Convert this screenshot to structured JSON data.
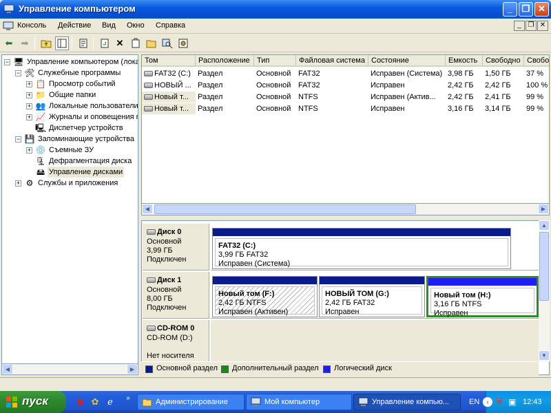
{
  "window": {
    "title": "Управление компьютером"
  },
  "menubar": {
    "items": [
      "Консоль",
      "Действие",
      "Вид",
      "Окно",
      "Справка"
    ]
  },
  "tree": {
    "items": [
      {
        "label": "Управление компьютером (локаль",
        "level": 0,
        "expander": "−",
        "icon": "computer-management-icon"
      },
      {
        "label": "Служебные программы",
        "level": 1,
        "expander": "−",
        "icon": "tools-icon"
      },
      {
        "label": "Просмотр событий",
        "level": 2,
        "expander": "+",
        "icon": "event-viewer-icon"
      },
      {
        "label": "Общие папки",
        "level": 2,
        "expander": "+",
        "icon": "shared-folders-icon"
      },
      {
        "label": "Локальные пользователи и",
        "level": 2,
        "expander": "+",
        "icon": "users-icon"
      },
      {
        "label": "Журналы и оповещения пр",
        "level": 2,
        "expander": "+",
        "icon": "logs-icon"
      },
      {
        "label": "Диспетчер устройств",
        "level": 2,
        "expander": "",
        "icon": "device-manager-icon"
      },
      {
        "label": "Запоминающие устройства",
        "level": 1,
        "expander": "−",
        "icon": "storage-icon"
      },
      {
        "label": "Съемные ЗУ",
        "level": 2,
        "expander": "+",
        "icon": "removable-storage-icon"
      },
      {
        "label": "Дефрагментация диска",
        "level": 2,
        "expander": "",
        "icon": "defrag-icon"
      },
      {
        "label": "Управление дисками",
        "level": 2,
        "expander": "",
        "icon": "disk-management-icon",
        "selected": true
      },
      {
        "label": "Службы и приложения",
        "level": 1,
        "expander": "+",
        "icon": "services-icon"
      }
    ]
  },
  "volumes": {
    "columns": [
      "Том",
      "Расположение",
      "Тип",
      "Файловая система",
      "Состояние",
      "Емкость",
      "Свободно",
      "Свобо"
    ],
    "rows": [
      [
        "FAT32 (C:)",
        "Раздел",
        "Основной",
        "FAT32",
        "Исправен (Система)",
        "3,98 ГБ",
        "1,50 ГБ",
        "37 %"
      ],
      [
        "НОВЫЙ ...",
        "Раздел",
        "Основной",
        "FAT32",
        "Исправен",
        "2,42 ГБ",
        "2,42 ГБ",
        "100 %"
      ],
      [
        "Новый т...",
        "Раздел",
        "Основной",
        "NTFS",
        "Исправен (Актив...",
        "2,42 ГБ",
        "2,41 ГБ",
        "99 %"
      ],
      [
        "Новый т...",
        "Раздел",
        "Основной",
        "NTFS",
        "Исправен",
        "3,16 ГБ",
        "3,14 ГБ",
        "99 %"
      ]
    ]
  },
  "disks": [
    {
      "name": "Диск 0",
      "type": "Основной",
      "size": "3,99 ГБ",
      "status": "Подключен",
      "partitions": [
        {
          "name": "FAT32  (C:)",
          "info": "3,99 ГБ FAT32",
          "status": "Исправен (Система)",
          "bar_color": "#0a1c8c"
        }
      ]
    },
    {
      "name": "Диск 1",
      "type": "Основной",
      "size": "8,00 ГБ",
      "status": "Подключен",
      "partitions": [
        {
          "name": "Новый том  (F:)",
          "info": "2,42 ГБ NTFS",
          "status": "Исправен (Активен)",
          "bar_color": "#0a1c8c"
        },
        {
          "name": "НОВЫЙ ТОМ  (G:)",
          "info": "2,42 ГБ FAT32",
          "status": "Исправен",
          "bar_color": "#0a1c8c"
        },
        {
          "name": "Новый том  (H:)",
          "info": "3,16 ГБ NTFS",
          "status": "Исправен",
          "bar_color": "#1d1ef0"
        }
      ]
    },
    {
      "name": "CD-ROM 0",
      "type": "CD-ROM (D:)",
      "size": "",
      "status": "Нет носителя",
      "partitions": []
    }
  ],
  "legend": [
    {
      "label": "Основной раздел",
      "color": "#0a1c8c"
    },
    {
      "label": "Дополнительный раздел",
      "color": "#1b8a1b"
    },
    {
      "label": "Логический диск",
      "color": "#1d1ef0"
    }
  ],
  "taskbar": {
    "start_label": "пуск",
    "tasks": [
      "Администрирование",
      "Мой компьютер",
      "Управление компью..."
    ],
    "language": "EN",
    "clock": "12:43"
  }
}
